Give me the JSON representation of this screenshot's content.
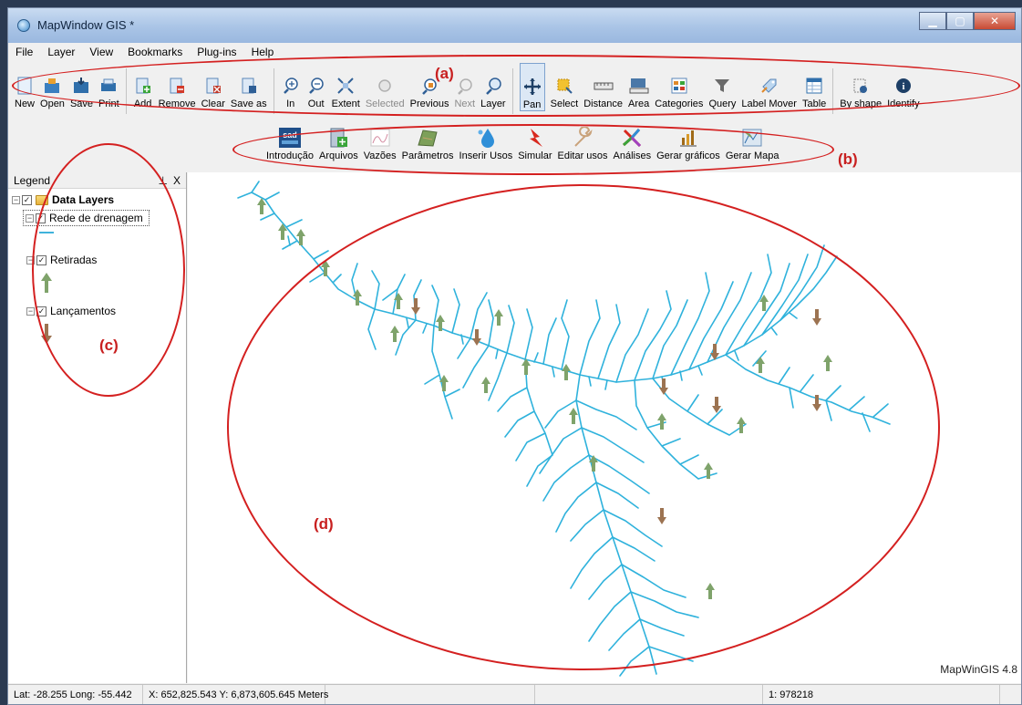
{
  "window": {
    "title": "MapWindow GIS *"
  },
  "menu": [
    "File",
    "Layer",
    "View",
    "Bookmarks",
    "Plug-ins",
    "Help"
  ],
  "toolbar_a": [
    {
      "label": "New",
      "icon": "new-doc-icon"
    },
    {
      "label": "Open",
      "icon": "open-icon"
    },
    {
      "label": "Save",
      "icon": "save-icon"
    },
    {
      "label": "Print",
      "icon": "print-icon"
    },
    {
      "label": "Add",
      "icon": "add-layer-icon"
    },
    {
      "label": "Remove",
      "icon": "remove-layer-icon"
    },
    {
      "label": "Clear",
      "icon": "clear-layers-icon"
    },
    {
      "label": "Save as",
      "icon": "save-as-icon"
    },
    {
      "label": "In",
      "icon": "zoom-in-icon"
    },
    {
      "label": "Out",
      "icon": "zoom-out-icon"
    },
    {
      "label": "Extent",
      "icon": "zoom-extent-icon"
    },
    {
      "label": "Selected",
      "icon": "zoom-selected-icon",
      "disabled": true
    },
    {
      "label": "Previous",
      "icon": "zoom-previous-icon"
    },
    {
      "label": "Next",
      "icon": "zoom-next-icon",
      "disabled": true
    },
    {
      "label": "Layer",
      "icon": "zoom-layer-icon"
    },
    {
      "label": "Pan",
      "icon": "pan-icon",
      "active": true
    },
    {
      "label": "Select",
      "icon": "select-icon"
    },
    {
      "label": "Distance",
      "icon": "distance-icon"
    },
    {
      "label": "Area",
      "icon": "area-icon"
    },
    {
      "label": "Categories",
      "icon": "categories-icon"
    },
    {
      "label": "Query",
      "icon": "query-icon"
    },
    {
      "label": "Label Mover",
      "icon": "label-mover-icon"
    },
    {
      "label": "Table",
      "icon": "table-icon"
    },
    {
      "label": "By shape",
      "icon": "by-shape-icon"
    },
    {
      "label": "Identify",
      "icon": "identify-icon"
    }
  ],
  "toolbar_b": [
    {
      "label": "Introdução",
      "icon": "sad-logo-icon",
      "logo_text": "sad"
    },
    {
      "label": "Arquivos",
      "icon": "files-icon"
    },
    {
      "label": "Vazões",
      "icon": "flow-chart-icon"
    },
    {
      "label": "Parâmetros",
      "icon": "parameters-icon"
    },
    {
      "label": "Inserir Usos",
      "icon": "water-drop-icon"
    },
    {
      "label": "Simular",
      "icon": "lightning-icon"
    },
    {
      "label": "Editar usos",
      "icon": "wrench-icon"
    },
    {
      "label": "Análises",
      "icon": "analysis-icon"
    },
    {
      "label": "Gerar gráficos",
      "icon": "bar-chart-icon"
    },
    {
      "label": "Gerar Mapa",
      "icon": "map-icon"
    }
  ],
  "legend": {
    "title": "Legend",
    "pin": "ᵖ",
    "close": "X",
    "group": "Data Layers",
    "layers": [
      {
        "name": "Rede de drenagem",
        "symbol": "line",
        "color": "#3fb3dc"
      },
      {
        "name": "Retiradas",
        "symbol": "arrow-up",
        "color": "#7fa36b"
      },
      {
        "name": "Lançamentos",
        "symbol": "arrow-down",
        "color": "#9c7351"
      }
    ]
  },
  "map": {
    "watermark": "MapWinGIS 4.8",
    "river_color": "#2fb2dc"
  },
  "status": {
    "latlong": "Lat: -28.255 Long: -55.442",
    "xy": "X: 652,825.543 Y: 6,873,605.645 Meters",
    "scale": "1: 978218"
  },
  "annotations": [
    "(a)",
    "(b)",
    "(c)",
    "(d)"
  ]
}
